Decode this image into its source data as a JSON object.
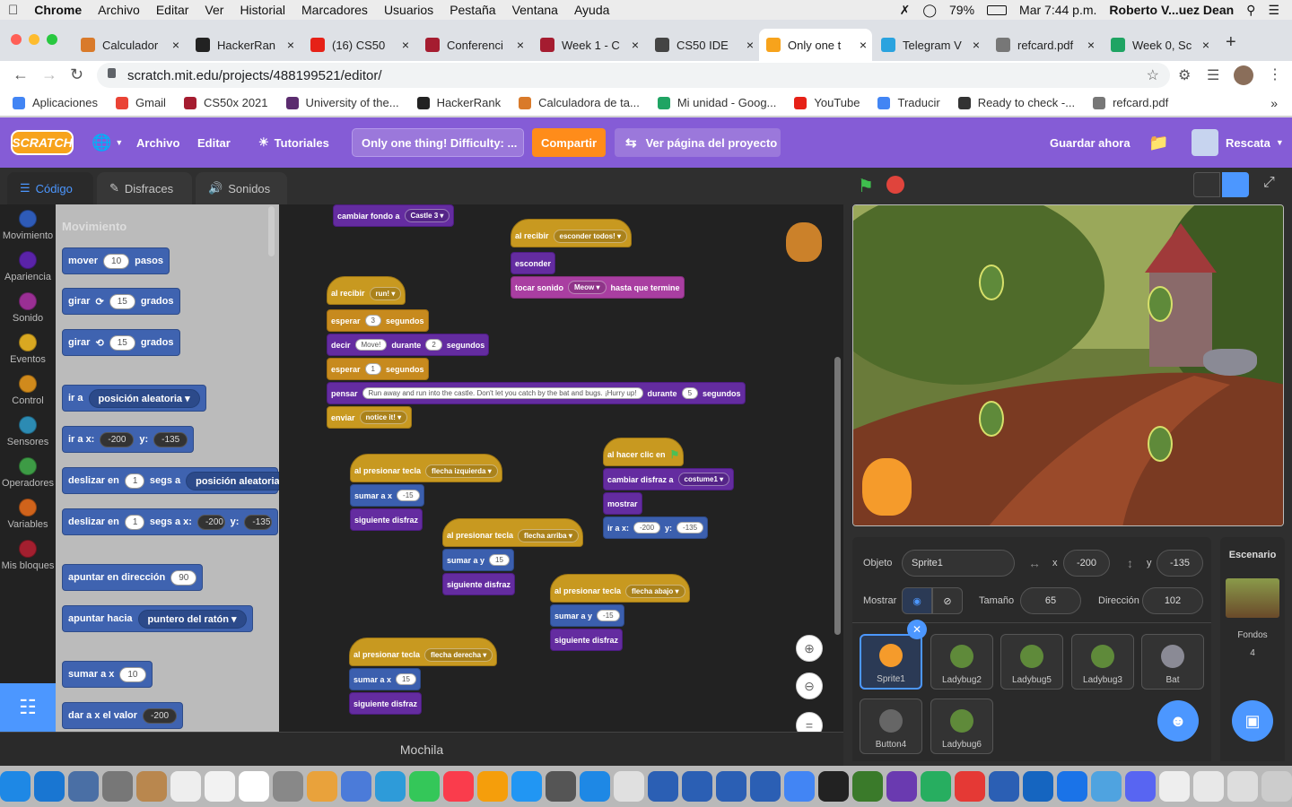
{
  "macbar": {
    "apple": "",
    "app": "Chrome",
    "menus": [
      "Archivo",
      "Editar",
      "Ver",
      "Historial",
      "Marcadores",
      "Usuarios",
      "Pestaña",
      "Ventana",
      "Ayuda"
    ],
    "battery": "79%",
    "clock": "Mar 7:44 p.m.",
    "user": "Roberto V...uez Dean"
  },
  "tabs": [
    {
      "title": "Calculador",
      "color": "#d97a2a"
    },
    {
      "title": "HackerRan",
      "color": "#222"
    },
    {
      "title": "(16) CS50",
      "color": "#e62117"
    },
    {
      "title": "Conferenci",
      "color": "#a51c30"
    },
    {
      "title": "Week 1 - C",
      "color": "#a51c30"
    },
    {
      "title": "CS50 IDE",
      "color": "#444"
    },
    {
      "title": "Only one t",
      "color": "#f7a31c"
    },
    {
      "title": "Telegram V",
      "color": "#2aa3df"
    },
    {
      "title": "refcard.pdf",
      "color": "#777"
    },
    {
      "title": "Week 0, Sc",
      "color": "#1fa463"
    }
  ],
  "address": {
    "url": "scratch.mit.edu/projects/488199521/editor/"
  },
  "bookmarks": [
    {
      "label": "Aplicaciones",
      "color": "#4285f4"
    },
    {
      "label": "Gmail",
      "color": "#ea4335"
    },
    {
      "label": "CS50x 2021",
      "color": "#a51c30"
    },
    {
      "label": "University of the...",
      "color": "#5b2c6f"
    },
    {
      "label": "HackerRank",
      "color": "#222"
    },
    {
      "label": "Calculadora de ta...",
      "color": "#d97a2a"
    },
    {
      "label": "Mi unidad - Goog...",
      "color": "#1fa463"
    },
    {
      "label": "YouTube",
      "color": "#e62117"
    },
    {
      "label": "Traducir",
      "color": "#4285f4"
    },
    {
      "label": "Ready to check -...",
      "color": "#333"
    },
    {
      "label": "refcard.pdf",
      "color": "#777"
    }
  ],
  "scratch": {
    "logo": "SCRATCH",
    "archivo": "Archivo",
    "editar": "Editar",
    "tutoriales": "Tutoriales",
    "title": "Only one thing! Difficulty: ...",
    "share": "Compartir",
    "see": "Ver página del proyecto",
    "save": "Guardar ahora",
    "user": "Rescata"
  },
  "editor": {
    "tabs": [
      "Código",
      "Disfraces",
      "Sonidos"
    ],
    "category_title": "Movimiento",
    "categories": [
      {
        "label": "Movimiento",
        "color": "#2e5bb8"
      },
      {
        "label": "Apariencia",
        "color": "#5a23a8"
      },
      {
        "label": "Sonido",
        "color": "#9a2f94"
      },
      {
        "label": "Eventos",
        "color": "#d9a821"
      },
      {
        "label": "Control",
        "color": "#d08a1c"
      },
      {
        "label": "Sensores",
        "color": "#2c8bb3"
      },
      {
        "label": "Operadores",
        "color": "#3d9b45"
      },
      {
        "label": "Variables",
        "color": "#d0631b"
      },
      {
        "label": "Mis bloques",
        "color": "#a31f2f"
      }
    ],
    "palette": {
      "move": [
        "mover",
        "10",
        "pasos"
      ],
      "turn_right": [
        "girar",
        "15",
        "grados"
      ],
      "turn_left": [
        "girar",
        "15",
        "grados"
      ],
      "goto": [
        "ir a",
        "posición aleatoria"
      ],
      "goto_xy": [
        "ir a x:",
        "-200",
        "y:",
        "-135"
      ],
      "glide": [
        "deslizar en",
        "1",
        "segs a",
        "posición aleatoria"
      ],
      "glide_xy": [
        "deslizar en",
        "1",
        "segs a x:",
        "-200",
        "y:",
        "-135"
      ],
      "point_dir": [
        "apuntar en dirección",
        "90"
      ],
      "point_to": [
        "apuntar hacia",
        "puntero del ratón"
      ],
      "change_x": [
        "sumar a x",
        "10"
      ],
      "set_x": [
        "dar a x el valor",
        "-200"
      ]
    },
    "mochila": "Mochila"
  },
  "blocks": {
    "b1": [
      "cambiar fondo a",
      "Castle 3"
    ],
    "b2": [
      "al recibir",
      "esconder todos!",
      "esconder",
      "tocar sonido",
      "Meow",
      "hasta que termine"
    ],
    "b3": [
      "al recibir",
      "run!",
      "esperar",
      "3",
      "segundos",
      "decir",
      "Move!",
      "durante",
      "2",
      "segundos",
      "esperar",
      "1",
      "segundos",
      "pensar",
      "Run away and run into the castle. Don't let you catch by the bat and bugs. ¡Hurry up!",
      "durante",
      "5",
      "segundos",
      "enviar",
      "notice it!"
    ],
    "b4": [
      "al presionar tecla",
      "flecha izquierda",
      "sumar a x",
      "-15",
      "siguiente disfraz"
    ],
    "b5": [
      "al hacer clic en",
      "cambiar disfraz a",
      "costume1",
      "mostrar",
      "ir a x:",
      "-200",
      "y:",
      "-135"
    ],
    "b6": [
      "al presionar tecla",
      "flecha arriba",
      "sumar a y",
      "15",
      "siguiente disfraz"
    ],
    "b7": [
      "al presionar tecla",
      "flecha abajo",
      "sumar a y",
      "-15",
      "siguiente disfraz"
    ],
    "b8": [
      "al presionar tecla",
      "flecha derecha",
      "sumar a x",
      "15",
      "siguiente disfraz"
    ]
  },
  "sprite_info": {
    "objeto_label": "Objeto",
    "name": "Sprite1",
    "x_label": "x",
    "x": "-200",
    "y_label": "y",
    "y": "-135",
    "mostrar": "Mostrar",
    "tamano_label": "Tamaño",
    "tamano": "65",
    "direccion_label": "Dirección",
    "direccion": "102"
  },
  "sprites": [
    "Sprite1",
    "Ladybug2",
    "Ladybug5",
    "Ladybug3",
    "Bat",
    "Button4",
    "Ladybug6"
  ],
  "stage_panel": {
    "title": "Escenario",
    "fondos_label": "Fondos",
    "fondos": "4"
  }
}
